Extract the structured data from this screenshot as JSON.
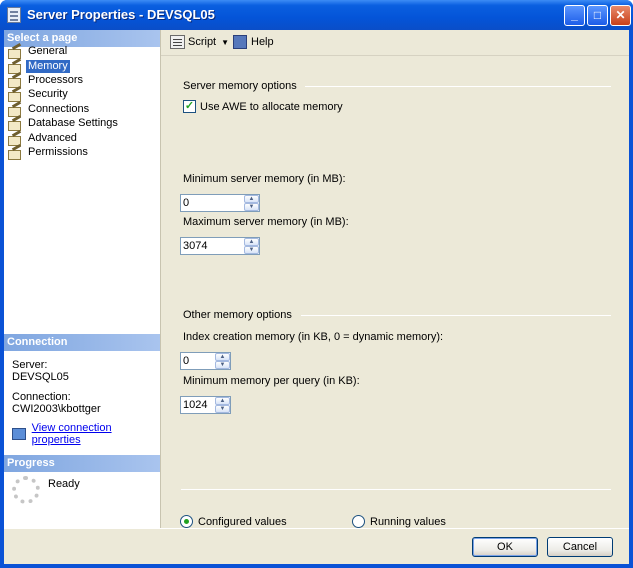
{
  "window": {
    "title": "Server Properties - DEVSQL05",
    "minimize_glyph": "_",
    "maximize_glyph": "□",
    "close_glyph": "✕"
  },
  "left_panel": {
    "select_page_header": "Select a page",
    "pages": [
      {
        "label": "General",
        "icon": "page-icon",
        "selected": false
      },
      {
        "label": "Memory",
        "icon": "page-icon",
        "selected": true
      },
      {
        "label": "Processors",
        "icon": "page-icon",
        "selected": false
      },
      {
        "label": "Security",
        "icon": "page-icon",
        "selected": false
      },
      {
        "label": "Connections",
        "icon": "page-icon",
        "selected": false
      },
      {
        "label": "Database Settings",
        "icon": "page-icon",
        "selected": false
      },
      {
        "label": "Advanced",
        "icon": "page-icon",
        "selected": false
      },
      {
        "label": "Permissions",
        "icon": "page-icon",
        "selected": false
      }
    ],
    "connection_header": "Connection",
    "server_label": "Server:",
    "server_value": "DEVSQL05",
    "connection_label": "Connection:",
    "connection_value": "CWI2003\\kbottger",
    "view_connection_link": "View connection properties",
    "progress_header": "Progress",
    "progress_status": "Ready"
  },
  "toolbar": {
    "script_label": "Script",
    "script_dropdown_glyph": "▼",
    "help_label": "Help"
  },
  "memory_page": {
    "server_memory_group": "Server memory options",
    "awe_checkbox_label": "Use AWE to allocate memory",
    "awe_checked": true,
    "min_server_memory_label": "Minimum server memory (in MB):",
    "min_server_memory_value": "0",
    "max_server_memory_label": "Maximum server memory (in MB):",
    "max_server_memory_value": "3074",
    "other_memory_group": "Other memory options",
    "index_creation_label": "Index creation memory (in KB, 0 = dynamic memory):",
    "index_creation_value": "0",
    "min_query_memory_label": "Minimum memory per query (in KB):",
    "min_query_memory_value": "1024",
    "configured_values_label": "Configured values",
    "configured_selected": true,
    "running_values_label": "Running values"
  },
  "footer": {
    "ok_label": "OK",
    "cancel_label": "Cancel"
  },
  "colors": {
    "titlebar": "#0454d8",
    "section_header": "#7fa6e0",
    "selected_item": "#316ac5",
    "dialog_bg": "#ece9d8"
  }
}
